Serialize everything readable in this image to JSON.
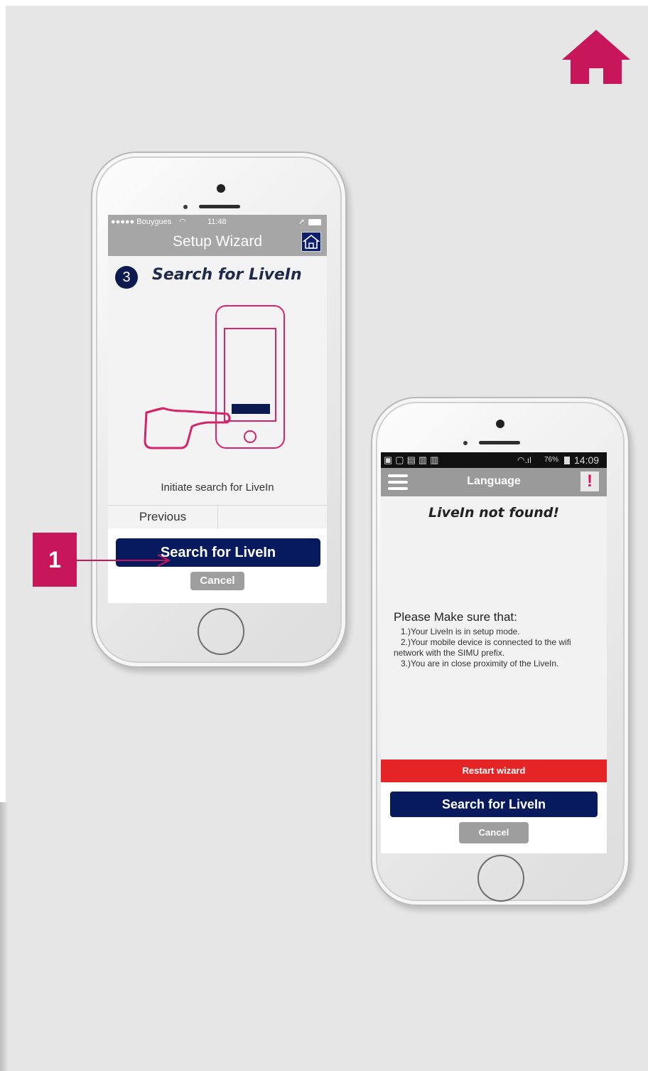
{
  "colors": {
    "background": "#e6e6e6",
    "accent": "#c8165a",
    "primary_button": "#081a5e",
    "cancel_button": "#9e9e9e",
    "restart_bar": "#e52525"
  },
  "icons": {
    "top_home": "home-icon",
    "nav_home": "home-outline-icon",
    "menu": "hamburger-menu-icon",
    "alert": "exclamation-icon"
  },
  "phone1": {
    "status": {
      "carrier": "●●●●● Bouygues",
      "time": "11:48"
    },
    "nav_title": "Setup Wizard",
    "step_number": "3",
    "step_title": "Search for LiveIn",
    "instruction": "Initiate search for LiveIn",
    "previous_label": "Previous",
    "search_label": "Search for LiveIn",
    "cancel_label": "Cancel"
  },
  "callout": {
    "label": "1"
  },
  "phone2": {
    "status": {
      "battery": "76%",
      "time": "14:09"
    },
    "nav_title": "Language",
    "alert_label": "!",
    "heading": "LiveIn not found!",
    "make_sure": "Please Make sure that:",
    "conditions": [
      "1.)Your LiveIn is in setup mode.",
      "2.)Your mobile device is connected to the wifi",
      "network with the SIMU prefix.",
      "3.)You are in close proximity of the LiveIn."
    ],
    "restart_label": "Restart wizard",
    "search_label": "Search for LiveIn",
    "cancel_label": "Cancel"
  }
}
